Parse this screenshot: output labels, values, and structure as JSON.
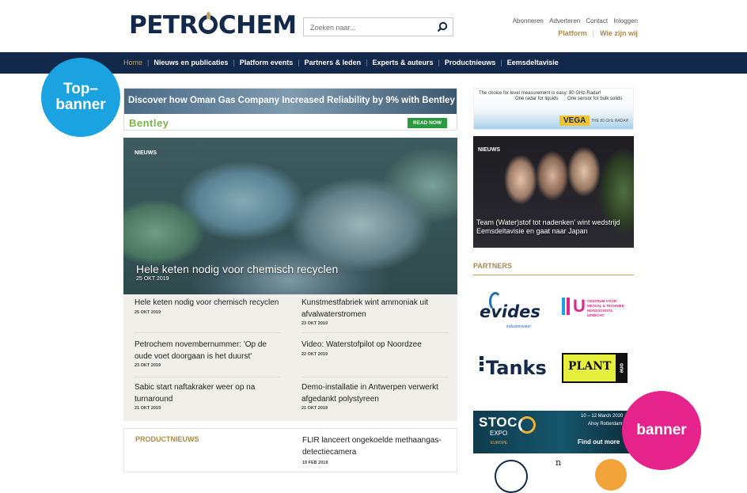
{
  "header": {
    "logo": "PETROCHEM",
    "logo_pre": "PETR",
    "logo_post": "CHEM",
    "search_placeholder": "Zoeken naar...",
    "top_links": [
      "Abonneren",
      "Adverteren",
      "Contact",
      "Inloggen"
    ],
    "sub_links": [
      "Platform",
      "Wie zijn wij"
    ]
  },
  "nav": {
    "items": [
      "Home",
      "Nieuws en publicaties",
      "Platform events",
      "Partners & leden",
      "Experts & auteurs",
      "Productnieuws",
      "Eemsdeltavisie"
    ]
  },
  "annotations": {
    "top_banner_line1": "Top–",
    "top_banner_line2": "banner",
    "banner": "banner"
  },
  "top_banner": {
    "headline": "Discover how Oman Gas Company Increased Reliability by 9% with Bentley AssetWise",
    "brand": "Bentley",
    "button": "READ NOW"
  },
  "hero": {
    "tag": "NIEUWS",
    "title": "Hele keten nodig voor chemisch recyclen",
    "date": "25 OKT 2019"
  },
  "news": [
    {
      "title": "Hele keten nodig voor chemisch recyclen",
      "date": "25 OKT 2019"
    },
    {
      "title": "Kunstmestfabriek wint ammoniak uit afvalwaterstromen",
      "date": "23 OKT 2019"
    },
    {
      "title": "Petrochem novembernummer: 'Op de oude voet doorgaan is het duurst'",
      "date": "23 OKT 2019"
    },
    {
      "title": "Video: Waterstofpilot op Noordzee",
      "date": "22 OKT 2019"
    },
    {
      "title": "Sabic start naftakraker weer op na turnaround",
      "date": "21 OKT 2019"
    },
    {
      "title": "Demo-installatie in Antwerpen verwerkt afgedankt polystyreen",
      "date": "21 OKT 2019"
    }
  ],
  "productnieuws": {
    "heading": "PRODUCTNIEUWS",
    "title": "FLIR lanceert ongekoelde methaangas-detectiecamera",
    "date": "19 FEB 2019"
  },
  "vega_ad": {
    "line1": "The choice for level measurement is easy: 80 GHz-Radar!",
    "radar_liquids": "One radar\nfor liquids",
    "sensor_solids": "One sensor\nfor bulk solids",
    "brand": "VEGA",
    "sub": "THE 80 GHz RADAR"
  },
  "right_news": {
    "tag": "NIEUWS",
    "title": "Team (Water)stof tot nadenken' wint wedstrijd Eemsdeltavisie en gaat naar Japan"
  },
  "partners": {
    "heading": "PARTNERS",
    "evides": "evides",
    "evides_sub": "industriewater",
    "hu": "U",
    "hu_text": "CENTRUM VOOR\nMETAAL & TECHNIEK\nHOGESCHOOL\nUTRECHT",
    "tanks": "Tanks",
    "plant": "PLANT",
    "plant_one": "one"
  },
  "stoc_ad": {
    "name": "STOC",
    "expo": "EXPO",
    "region": "EUROPE",
    "dates": "10 – 12 March 2020",
    "venue": "Ahoy Rotterdam",
    "cta": "Find out more"
  },
  "bottom": {
    "n": "n"
  },
  "colors": {
    "navy": "#13294b",
    "gold": "#c7a25a",
    "blue_badge": "#1aa3e0",
    "pink_badge": "#e6238a"
  }
}
